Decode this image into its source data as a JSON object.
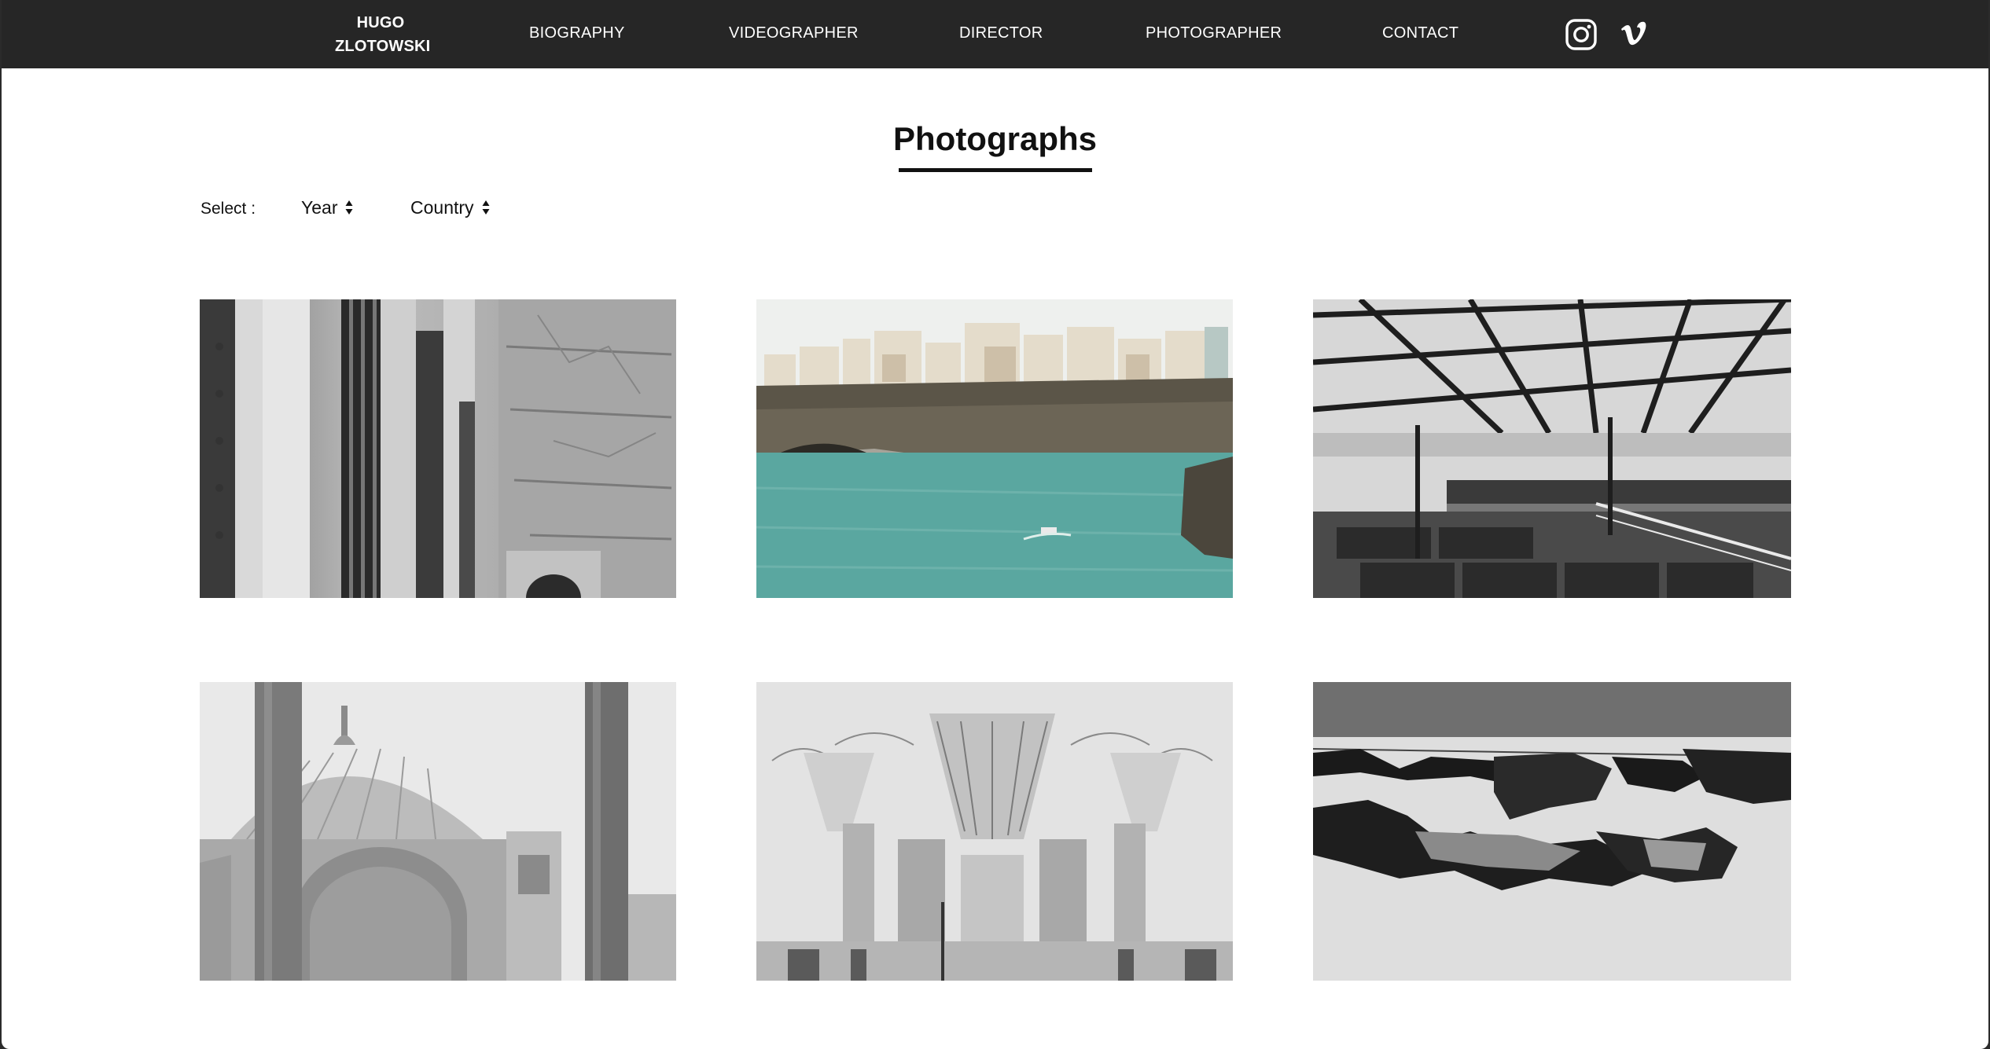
{
  "header": {
    "brand_line1": "HUGO",
    "brand_line2": "ZLOTOWSKI",
    "nav": [
      {
        "label": "BIOGRAPHY"
      },
      {
        "label": "VIDEOGRAPHER"
      },
      {
        "label": "DIRECTOR"
      },
      {
        "label": "PHOTOGRAPHER"
      },
      {
        "label": "CONTACT"
      }
    ],
    "social_icons": [
      "instagram-icon",
      "vimeo-icon"
    ]
  },
  "page": {
    "title": "Photographs"
  },
  "filters": {
    "label": "Select :",
    "year_label": "Year",
    "country_label": "Country"
  },
  "gallery": {
    "photos": [
      {
        "subject": "stone building facade with barred windows",
        "palette": "black-and-white"
      },
      {
        "subject": "cliffside town above turquoise sea with small boat",
        "palette": "color"
      },
      {
        "subject": "ferry deck benches under metal roof frame",
        "palette": "black-and-white"
      },
      {
        "subject": "mosque dome between tall columns",
        "palette": "black-and-white"
      },
      {
        "subject": "ornate chandeliers in mosque interior",
        "palette": "black-and-white"
      },
      {
        "subject": "laundry hanging on a line",
        "palette": "black-and-white"
      }
    ]
  },
  "colors": {
    "nav_background": "#262626",
    "nav_text": "#ffffff",
    "page_background": "#ffffff",
    "text": "#111111",
    "sea": "#5aa7a0"
  }
}
